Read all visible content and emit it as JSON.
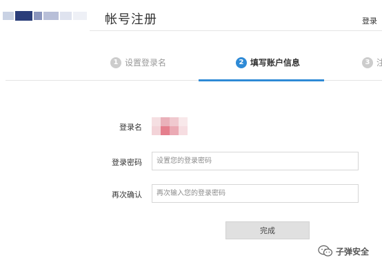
{
  "header": {
    "title": "帐号注册",
    "login_label": "登录"
  },
  "steps": [
    {
      "number": "1",
      "label": "设置登录名",
      "state": "done"
    },
    {
      "number": "2",
      "label": "填写账户信息",
      "state": "active"
    },
    {
      "number": "3",
      "label": "注",
      "state": "pending"
    }
  ],
  "form": {
    "username_label": "登录名",
    "password_label": "登录密码",
    "password_placeholder": "设置您的登录密码",
    "confirm_label": "再次确认",
    "confirm_placeholder": "再次输入您的登录密码",
    "submit_label": "完成"
  },
  "watermark": {
    "text": "子弹安全"
  },
  "colors": {
    "accent": "#2e8ad6",
    "inactive_step": "#cccccc"
  }
}
